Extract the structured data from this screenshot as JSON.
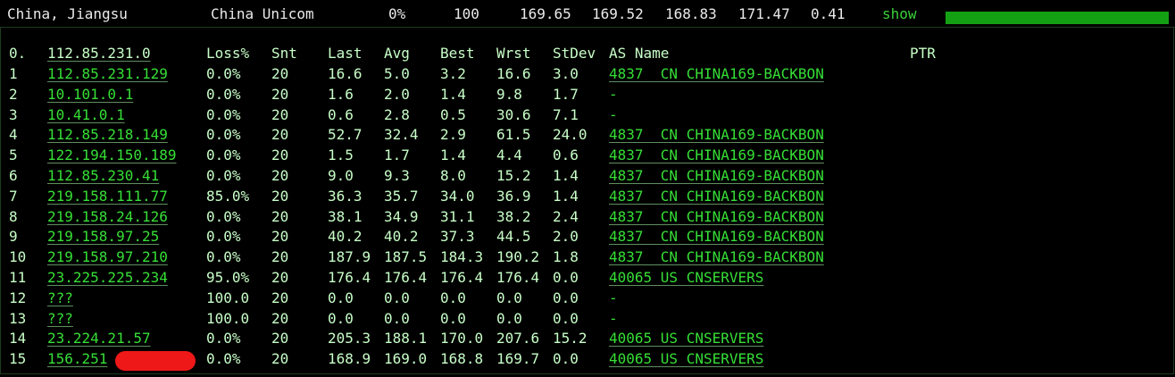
{
  "summary": {
    "location": "China, Jiangsu",
    "isp": "China Unicom",
    "loss": "0%",
    "sent": "100",
    "last": "169.65",
    "avg": "169.52",
    "best": "168.83",
    "worst": "171.47",
    "stdev": "0.41",
    "show_label": "show",
    "progress_fraction": 1.0,
    "colors": {
      "accent": "#36df36",
      "bar": "#13a113",
      "background": "#000000"
    }
  },
  "table": {
    "headers": {
      "hop": "0.",
      "host": "112.85.231.0",
      "loss": "Loss%",
      "snt": "Snt",
      "last": "Last",
      "avg": "Avg",
      "best": "Best",
      "wrst": "Wrst",
      "stdev": "StDev",
      "asname": "AS Name",
      "ptr": "PTR"
    },
    "rows": [
      {
        "hop": "1",
        "host": "112.85.231.129",
        "loss": "0.0%",
        "snt": "20",
        "last": "16.6",
        "avg": "5.0",
        "best": "3.2",
        "wrst": "16.6",
        "stdev": "3.0",
        "asname": "4837  CN CHINA169-BACKBON"
      },
      {
        "hop": "2",
        "host": "10.101.0.1",
        "loss": "0.0%",
        "snt": "20",
        "last": "1.6",
        "avg": "2.0",
        "best": "1.4",
        "wrst": "9.8",
        "stdev": "1.7",
        "asname": "-"
      },
      {
        "hop": "3",
        "host": "10.41.0.1",
        "loss": "0.0%",
        "snt": "20",
        "last": "0.6",
        "avg": "2.8",
        "best": "0.5",
        "wrst": "30.6",
        "stdev": "7.1",
        "asname": "-"
      },
      {
        "hop": "4",
        "host": "112.85.218.149",
        "loss": "0.0%",
        "snt": "20",
        "last": "52.7",
        "avg": "32.4",
        "best": "2.9",
        "wrst": "61.5",
        "stdev": "24.0",
        "asname": "4837  CN CHINA169-BACKBON"
      },
      {
        "hop": "5",
        "host": "122.194.150.189",
        "loss": "0.0%",
        "snt": "20",
        "last": "1.5",
        "avg": "1.7",
        "best": "1.4",
        "wrst": "4.4",
        "stdev": "0.6",
        "asname": "4837  CN CHINA169-BACKBON"
      },
      {
        "hop": "6",
        "host": "112.85.230.41",
        "loss": "0.0%",
        "snt": "20",
        "last": "9.0",
        "avg": "9.3",
        "best": "8.0",
        "wrst": "15.2",
        "stdev": "1.4",
        "asname": "4837  CN CHINA169-BACKBON"
      },
      {
        "hop": "7",
        "host": "219.158.111.77",
        "loss": "85.0%",
        "snt": "20",
        "last": "36.3",
        "avg": "35.7",
        "best": "34.0",
        "wrst": "36.9",
        "stdev": "1.4",
        "asname": "4837  CN CHINA169-BACKBON"
      },
      {
        "hop": "8",
        "host": "219.158.24.126",
        "loss": "0.0%",
        "snt": "20",
        "last": "38.1",
        "avg": "34.9",
        "best": "31.1",
        "wrst": "38.2",
        "stdev": "2.4",
        "asname": "4837  CN CHINA169-BACKBON"
      },
      {
        "hop": "9",
        "host": "219.158.97.25",
        "loss": "0.0%",
        "snt": "20",
        "last": "40.2",
        "avg": "40.2",
        "best": "37.3",
        "wrst": "44.5",
        "stdev": "2.0",
        "asname": "4837  CN CHINA169-BACKBON"
      },
      {
        "hop": "10",
        "host": "219.158.97.210",
        "loss": "0.0%",
        "snt": "20",
        "last": "187.9",
        "avg": "187.5",
        "best": "184.3",
        "wrst": "190.2",
        "stdev": "1.8",
        "asname": "4837  CN CHINA169-BACKBON"
      },
      {
        "hop": "11",
        "host": "23.225.225.234",
        "loss": "95.0%",
        "snt": "20",
        "last": "176.4",
        "avg": "176.4",
        "best": "176.4",
        "wrst": "176.4",
        "stdev": "0.0",
        "asname": "40065 US CNSERVERS"
      },
      {
        "hop": "12",
        "host": "???",
        "loss": "100.0",
        "snt": "20",
        "last": "0.0",
        "avg": "0.0",
        "best": "0.0",
        "wrst": "0.0",
        "stdev": "0.0",
        "asname": "-"
      },
      {
        "hop": "13",
        "host": "???",
        "loss": "100.0",
        "snt": "20",
        "last": "0.0",
        "avg": "0.0",
        "best": "0.0",
        "wrst": "0.0",
        "stdev": "0.0",
        "asname": "-"
      },
      {
        "hop": "14",
        "host": "23.224.21.57",
        "loss": "0.0%",
        "snt": "20",
        "last": "205.3",
        "avg": "188.1",
        "best": "170.0",
        "wrst": "207.6",
        "stdev": "15.2",
        "asname": "40065 US CNSERVERS"
      },
      {
        "hop": "15",
        "host": "156.251",
        "loss": "0.0%",
        "snt": "20",
        "last": "168.9",
        "avg": "169.0",
        "best": "168.8",
        "wrst": "169.7",
        "stdev": "0.0",
        "asname": "40065 US CNSERVERS",
        "redacted": true
      }
    ]
  }
}
